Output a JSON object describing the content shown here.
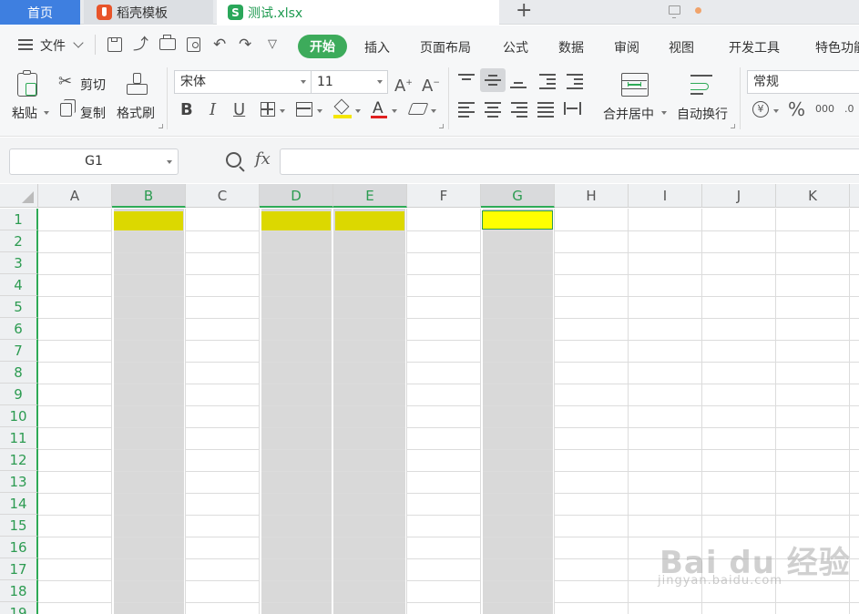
{
  "tabs": {
    "home": "首页",
    "template": "稻壳模板",
    "file": "测试.xlsx",
    "file_icon_letter": "S"
  },
  "menu": {
    "file_label": "文件",
    "items": [
      "开始",
      "插入",
      "页面布局",
      "公式",
      "数据",
      "审阅",
      "视图",
      "开发工具",
      "特色功能"
    ]
  },
  "ribbon": {
    "paste": "粘贴",
    "cut": "剪切",
    "copy": "复制",
    "format_painter": "格式刷",
    "font_name": "宋体",
    "font_size": "11",
    "bold": "B",
    "italic": "I",
    "underline": "U",
    "font_color_letter": "A",
    "merge_center": "合并居中",
    "wrap_text": "自动换行",
    "number_format": "常规",
    "percent": "%",
    "thousands": "000",
    "decimal": ".0"
  },
  "formula_bar": {
    "name_box": "G1",
    "fx": "fx",
    "value": ""
  },
  "grid": {
    "columns": [
      "A",
      "B",
      "C",
      "D",
      "E",
      "F",
      "G",
      "H",
      "I",
      "J",
      "K"
    ],
    "selected_columns": [
      "B",
      "D",
      "E",
      "G"
    ],
    "rows": [
      "1",
      "2",
      "3",
      "4",
      "5",
      "6",
      "7",
      "8",
      "9",
      "10",
      "11",
      "12",
      "13",
      "14",
      "15",
      "16",
      "17",
      "18",
      "19"
    ],
    "active_cell": "G1",
    "fill_colors": {
      "B1": "#dcd800",
      "D1": "#dcd800",
      "E1": "#dcd800",
      "G1": "#ffff00"
    },
    "accent": "#2eaa56"
  },
  "watermark": {
    "brand": "Bai du 经验",
    "url": "jingyan.baidu.com"
  }
}
